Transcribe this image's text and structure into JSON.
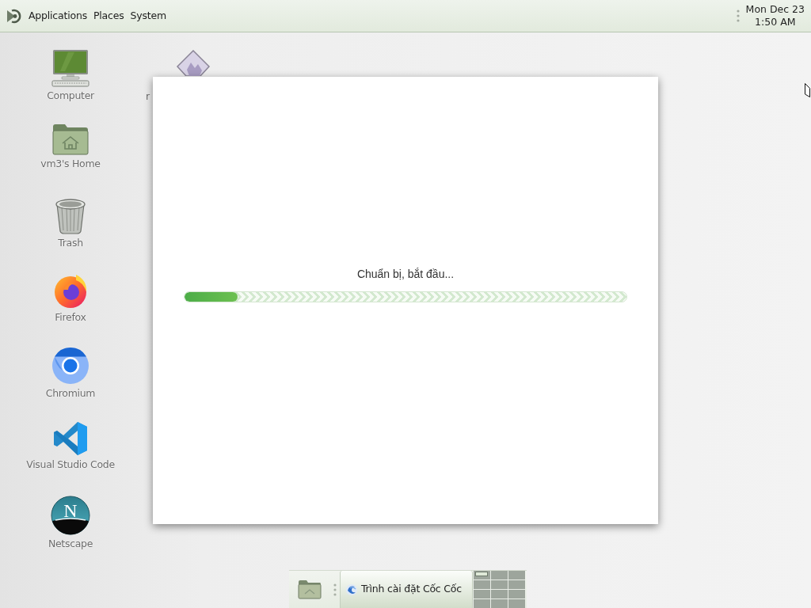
{
  "top_panel": {
    "menus": [
      {
        "label": "Applications"
      },
      {
        "label": "Places"
      },
      {
        "label": "System"
      }
    ],
    "clock": {
      "date": "Mon Dec 23",
      "time": "1:50 AM"
    }
  },
  "desktop_icons": [
    {
      "kind": "computer",
      "label": "Computer"
    },
    {
      "kind": "home",
      "label": "vm3's Home"
    },
    {
      "kind": "trash",
      "label": "Trash"
    },
    {
      "kind": "firefox",
      "label": "Firefox"
    },
    {
      "kind": "chromium",
      "label": "Chromium"
    },
    {
      "kind": "vscode",
      "label": "Visual Studio Code"
    },
    {
      "kind": "netscape",
      "label": "Netscape",
      "glyph": "N"
    }
  ],
  "covered_icon": {
    "label": "r"
  },
  "installer_window": {
    "status": "Chuẩn bị, bắt đầu...",
    "progress": {
      "level": 0.12
    }
  },
  "bottom_panel": {
    "tasks": [
      {
        "label": "Trình cài đặt Cốc Cốc",
        "selected": true
      }
    ],
    "workspaces": [
      {
        "has_window": true
      },
      {
        "has_window": false
      },
      {
        "has_window": false
      },
      {
        "has_window": false
      },
      {
        "has_window": false
      },
      {
        "has_window": false
      },
      {
        "has_window": false
      },
      {
        "has_window": false
      },
      {
        "has_window": false
      },
      {
        "has_window": false
      },
      {
        "has_window": false
      },
      {
        "has_window": false
      }
    ]
  }
}
